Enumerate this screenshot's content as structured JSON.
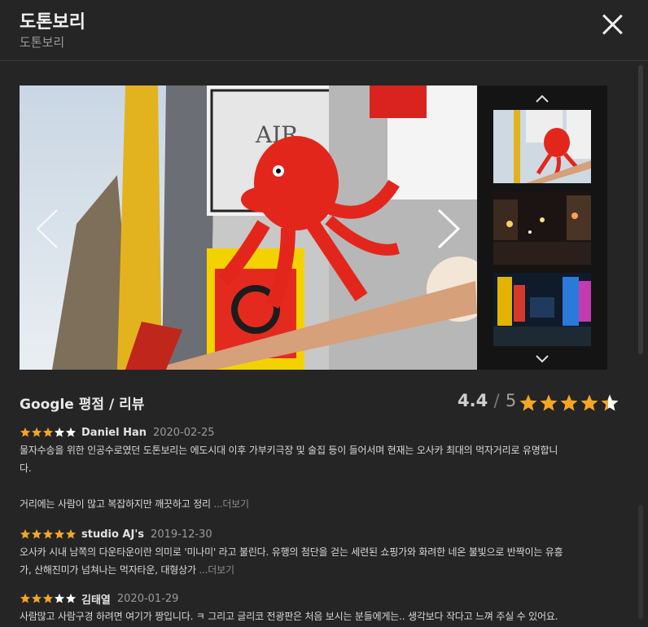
{
  "header": {
    "title": "도톤보리",
    "subtitle": "도톤보리"
  },
  "gallery": {
    "prev_icon": "chevron-left-icon",
    "next_icon": "chevron-right-icon",
    "thumbs_up_icon": "chevron-up-icon",
    "thumbs_down_icon": "chevron-down-icon"
  },
  "rating": {
    "heading": "Google 평점 / 리뷰",
    "score": "4.4",
    "separator": "/",
    "max": "5",
    "stars_value": 4.4,
    "star_color": "#f5a623"
  },
  "reviews": [
    {
      "stars": 3,
      "author": "Daniel Han",
      "date": "2020-02-25",
      "lines": [
        "물자수송을 위한 인공수로였던 도톤보리는 에도시대 이후 가부키극장 및 술집 등이 들어서며 현재는 오사카 최대의 먹자거리로 유명합니",
        "다.",
        "",
        "거리에는 사람이 많고 복잡하지만 깨끗하고 정리 "
      ],
      "more": "...더보기"
    },
    {
      "stars": 5,
      "author": "studio AJ's",
      "date": "2019-12-30",
      "lines": [
        "오사카 시내 남쪽의 다운타운이란 의미로 '미나미' 라고 불린다. 유행의 첨단을 걷는 세련된 쇼핑가와 화려한 네온 불빛으로 반짝이는 유흥",
        "가, 산해진미가 넘쳐나는 먹자타운, 대형상가 "
      ],
      "more": "...더보기"
    },
    {
      "stars": 3,
      "author": "김태열",
      "date": "2020-01-29",
      "lines": [
        "사람많고 사람구경 하려면 여기가 짱입니다. ㅋ 그리고 글리코 전광판은 처음 보시는 분들에게는.. 생각보다 작다고 느껴 주실 수 있어요."
      ],
      "more": ""
    }
  ]
}
